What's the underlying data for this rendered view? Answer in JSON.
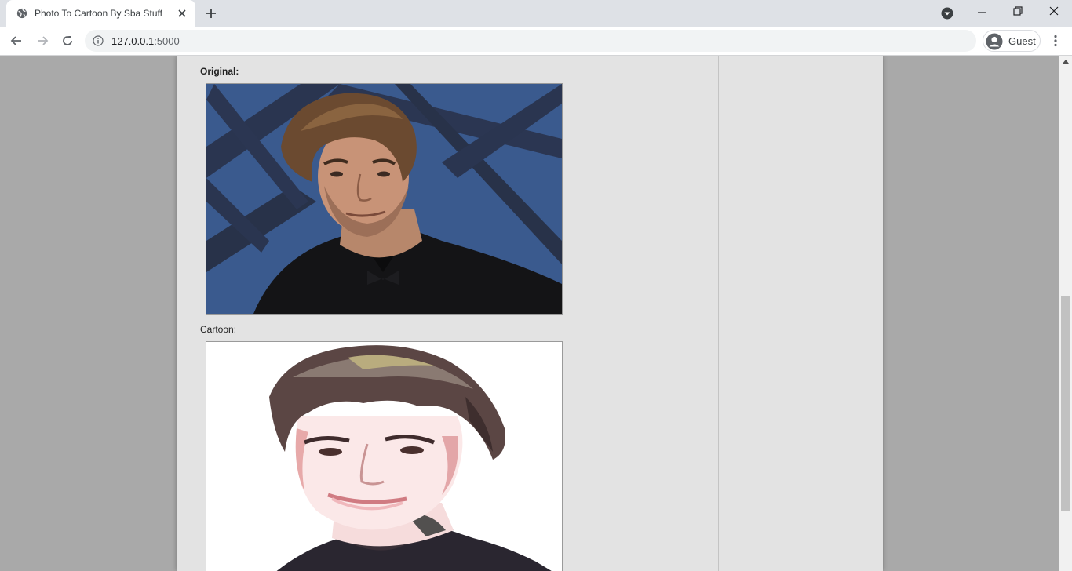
{
  "browser": {
    "tab_title": "Photo To Cartoon By Sba Stuff",
    "url_host": "127.0.0.1",
    "url_port": ":5000",
    "profile_label": "Guest"
  },
  "icons": {
    "favicon": "globe-icon",
    "tab_close": "close-icon",
    "new_tab": "plus-icon",
    "tab_search": "tab-search-icon",
    "back": "arrow-left-icon",
    "forward": "arrow-right-icon",
    "reload": "reload-icon",
    "site_info": "info-icon",
    "avatar": "user-avatar-icon",
    "menu": "more-vert-icon"
  },
  "page": {
    "original_label": "Original:",
    "cartoon_label": "Cartoon:"
  },
  "colors": {
    "page_bg": "#a9a9a9",
    "content_bg": "#e3e3e3",
    "photo_bg_blue": "#3b5a8c",
    "cartoon_bg": "#ffffff"
  }
}
